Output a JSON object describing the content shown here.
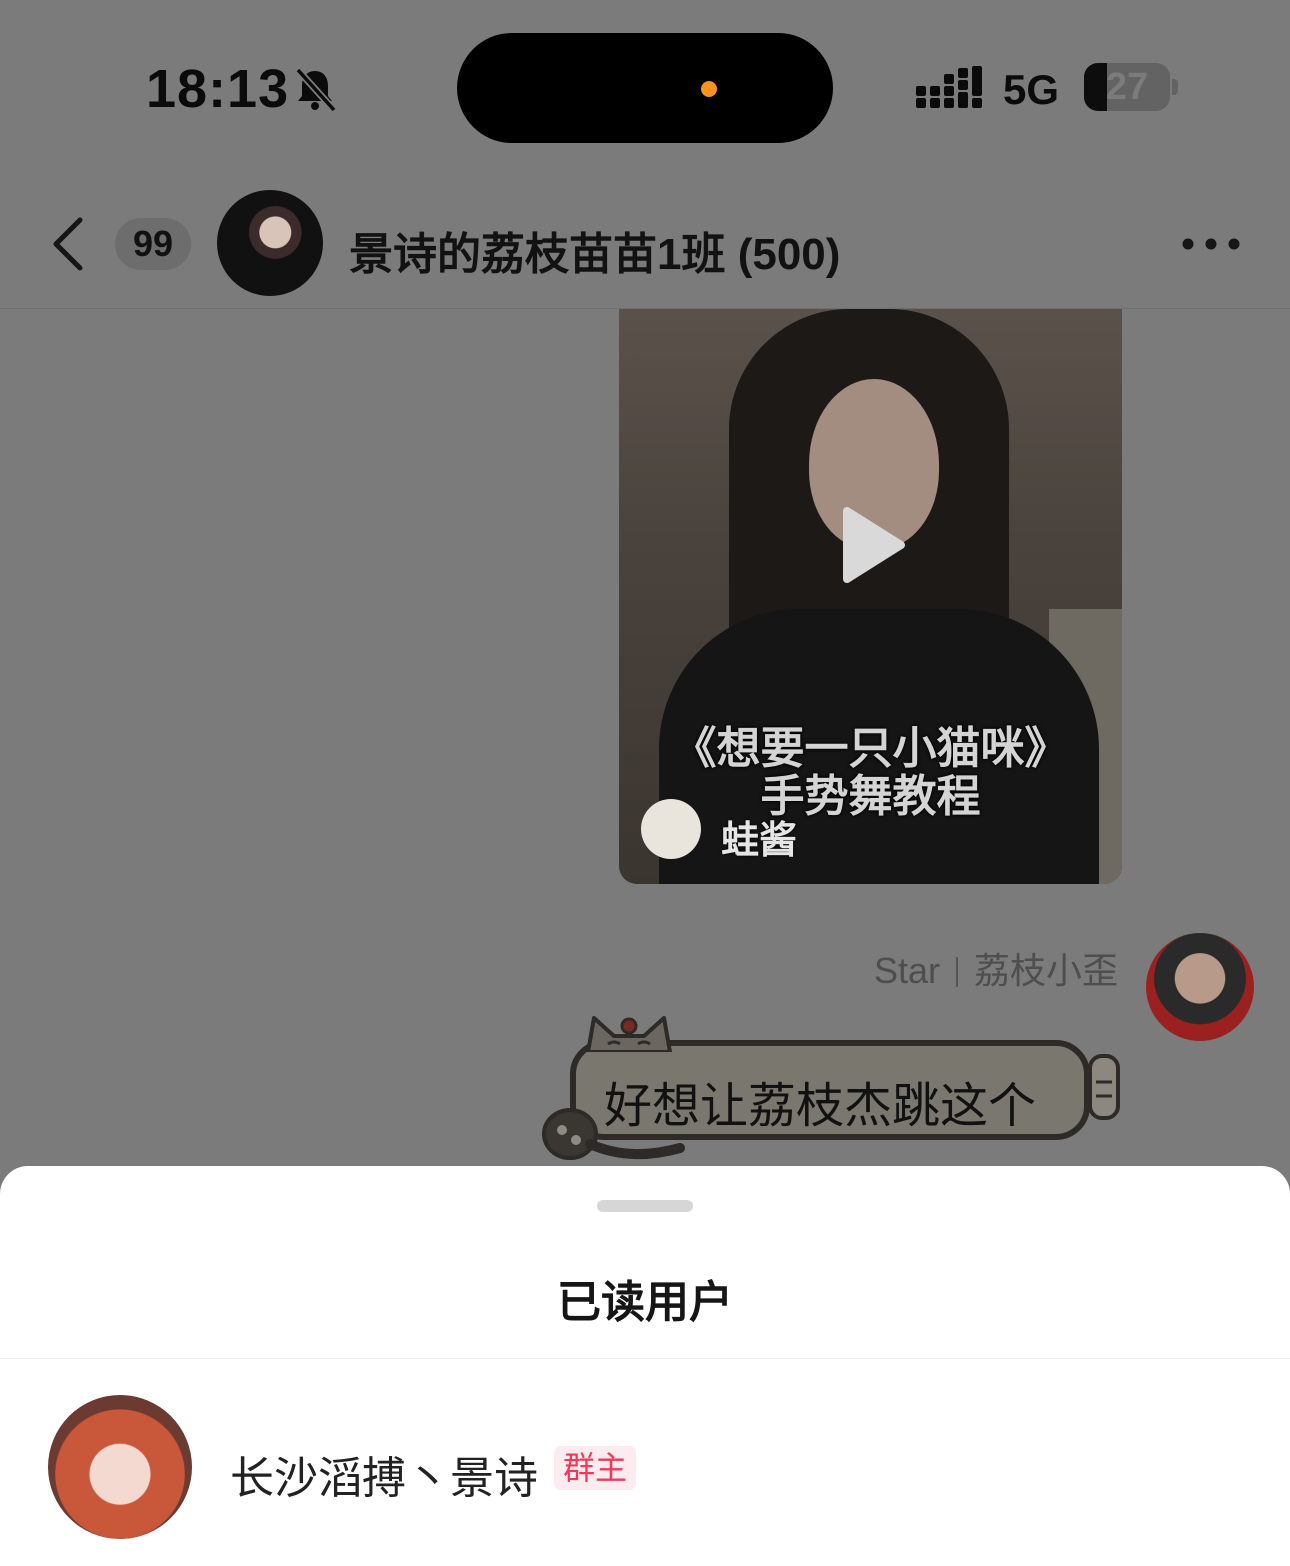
{
  "status_bar": {
    "time": "18:13",
    "network": "5G",
    "battery": "27",
    "icons": [
      "bell-slash-icon",
      "signal-icon"
    ],
    "island_dot_color": "#f7931e"
  },
  "header": {
    "unread_count": "99",
    "group_name": "景诗的荔枝苗苗1班 (500)",
    "icons": [
      "back-icon",
      "more-icon"
    ]
  },
  "video": {
    "title_line1": "《想要一只小猫咪》",
    "title_line2": "手势舞教程",
    "author": "蛙酱",
    "icon": "play-icon"
  },
  "message": {
    "sender_tag": "Star",
    "sender_name": "荔枝小歪",
    "text": "好想让荔枝杰跳这个"
  },
  "sheet": {
    "title": "已读用户",
    "readers": [
      {
        "name": "长沙滔搏丶景诗",
        "badge": "群主",
        "badge_color": "#ef3b5b"
      }
    ]
  }
}
